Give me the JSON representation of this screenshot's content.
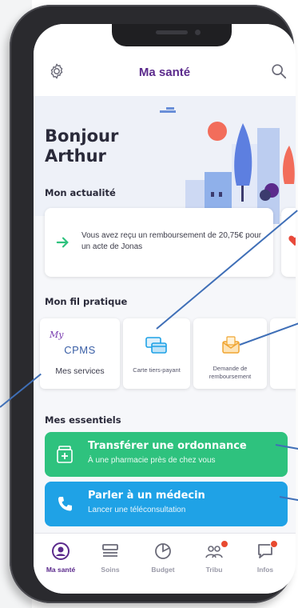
{
  "header": {
    "title": "Ma santé"
  },
  "hero": {
    "greeting_line1": "Bonjour",
    "greeting_line2": "Arthur"
  },
  "sections": {
    "news": "Mon actualité",
    "practical": "Mon fil pratique",
    "essentials": "Mes essentiels"
  },
  "news_card": {
    "text": "Vous avez reçu un remboursement de 20,75€ pour un acte de Jonas"
  },
  "practical_tiles": [
    {
      "brand_my": "My",
      "brand_name": "CPMS",
      "label": "Mes services"
    },
    {
      "label": "Carte tiers-payant"
    },
    {
      "label": "Demande de remboursement"
    }
  ],
  "essentials": [
    {
      "title": "Transférer une ordonnance",
      "subtitle": "À une pharmacie près de chez vous"
    },
    {
      "title": "Parler à un médecin",
      "subtitle": "Lancer une téléconsultation"
    }
  ],
  "bottom_nav": [
    {
      "label": "Ma santé",
      "active": true
    },
    {
      "label": "Soins"
    },
    {
      "label": "Budget"
    },
    {
      "label": "Tribu"
    },
    {
      "label": "Infos"
    }
  ],
  "colors": {
    "brand_purple": "#5b2a8c",
    "green": "#2ec27e",
    "blue": "#1fa2e6",
    "callout": "#3f6fb7"
  }
}
